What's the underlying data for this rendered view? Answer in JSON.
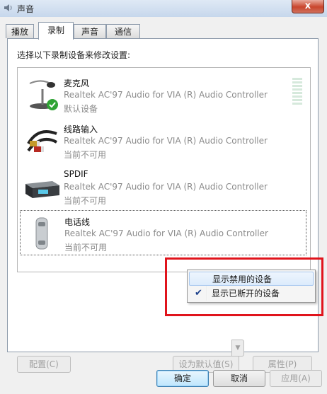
{
  "window": {
    "title": "声音",
    "close_label": "x"
  },
  "tabs": [
    {
      "label": "播放",
      "active": false
    },
    {
      "label": "录制",
      "active": true
    },
    {
      "label": "声音",
      "active": false
    },
    {
      "label": "通信",
      "active": false
    }
  ],
  "panel": {
    "caption": "选择以下录制设备来修改设置:"
  },
  "devices": [
    {
      "name": "麦克风",
      "description": "Realtek AC'97 Audio for VIA (R) Audio Controller",
      "status": "默认设备",
      "icon": "microphone-icon",
      "default": true
    },
    {
      "name": "线路输入",
      "description": "Realtek AC'97 Audio for VIA (R) Audio Controller",
      "status": "当前不可用",
      "icon": "line-in-cable-icon"
    },
    {
      "name": "SPDIF",
      "description": "Realtek AC'97 Audio for VIA (R) Audio Controller",
      "status": "当前不可用",
      "icon": "spdif-device-icon"
    },
    {
      "name": "电话线",
      "description": "Realtek AC'97 Audio for VIA (R) Audio Controller",
      "status": "当前不可用",
      "icon": "telephone-handset-icon",
      "selected": true
    }
  ],
  "context_menu": {
    "items": [
      {
        "label": "显示禁用的设备",
        "checked": false
      },
      {
        "label": "显示已断开的设备",
        "checked": true
      }
    ]
  },
  "buttons": {
    "configure": "配置(C)",
    "set_default": "设为默认值(S)",
    "properties": "属性(P)",
    "ok": "确定",
    "cancel": "取消",
    "apply": "应用(A)"
  },
  "colors": {
    "highlight_box": "#e0141c",
    "accent": "#3c7fb1"
  }
}
